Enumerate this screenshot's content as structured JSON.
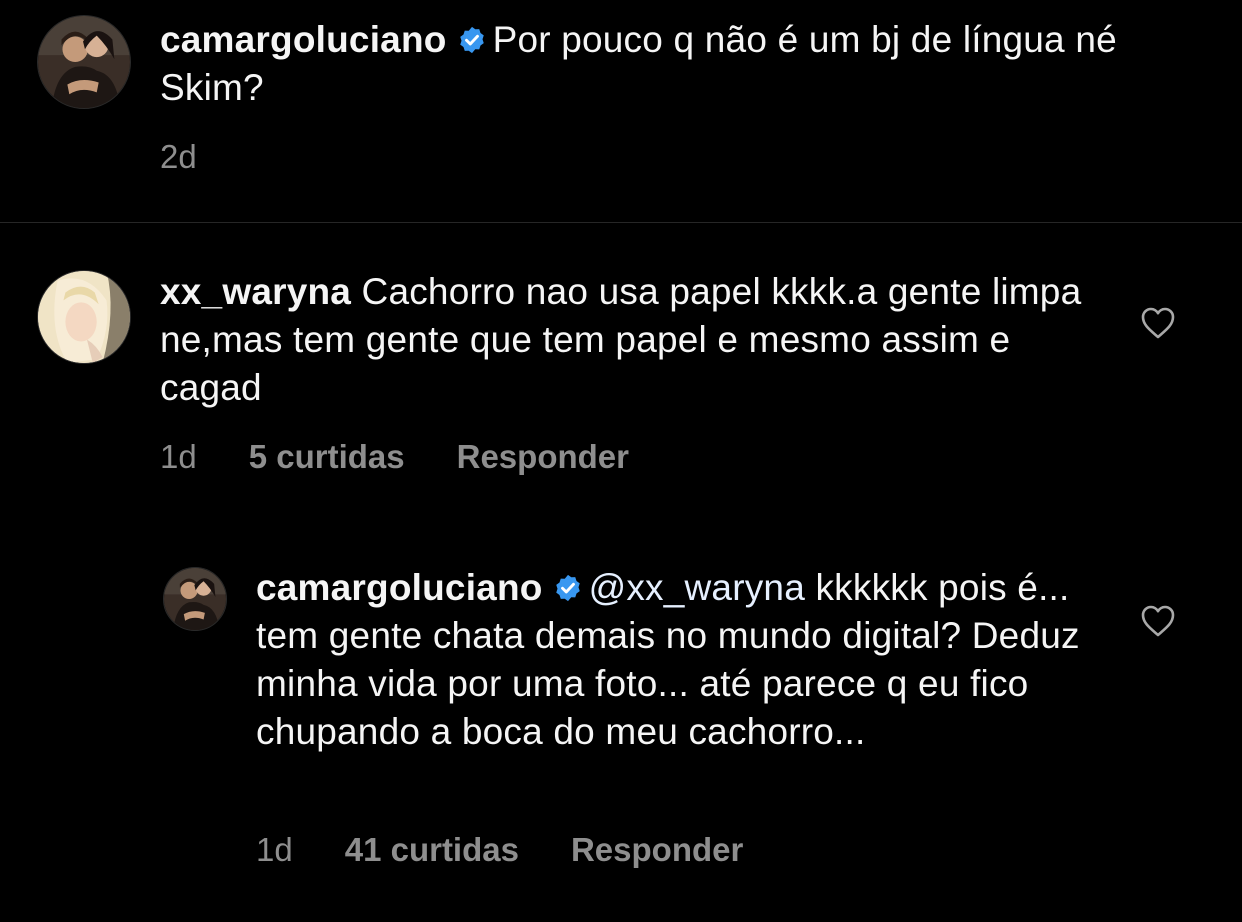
{
  "caption": {
    "username": "camargoluciano",
    "text": "Por pouco q não é um bj de língua né Skim?",
    "time": "2d"
  },
  "comments": [
    {
      "username": "xx_waryna",
      "text": "Cachorro nao usa papel kkkk.a gente limpa ne,mas tem gente que tem papel e mesmo assim e cagad",
      "time": "1d",
      "likes": "5 curtidas",
      "reply_label": "Responder"
    }
  ],
  "replies": [
    {
      "username": "camargoluciano",
      "mention": "@xx_waryna",
      "text": "kkkkkk pois é... tem gente chata demais no mundo digital? Deduz minha vida por uma foto... até parece q eu fico chupando a boca do meu cachorro...",
      "time": "1d",
      "likes": "41 curtidas",
      "reply_label": "Responder"
    }
  ],
  "icons": {
    "verified": "verified-badge-icon",
    "like": "heart-outline-icon"
  },
  "colors": {
    "background": "#000000",
    "text": "#f5f5f5",
    "secondary": "#8e8e8e",
    "verified": "#3897f0",
    "divider": "#262626"
  }
}
